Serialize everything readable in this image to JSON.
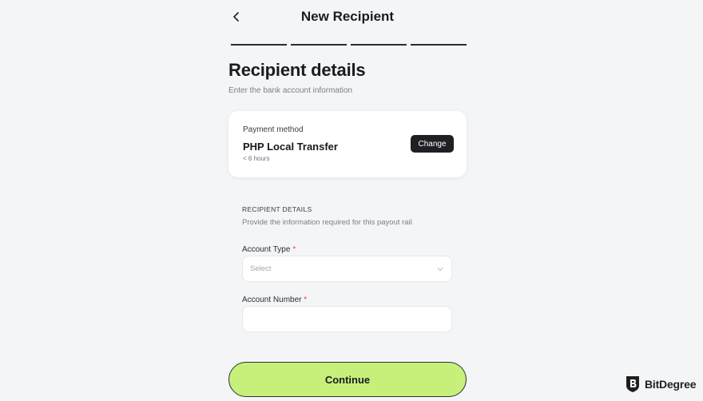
{
  "header": {
    "back_icon": "chevron-left-icon",
    "title": "New Recipient",
    "steps_count": 4
  },
  "section": {
    "title": "Recipient details",
    "subtitle": "Enter the bank account information"
  },
  "payment_method": {
    "label": "Payment method",
    "value": "PHP Local Transfer",
    "eta": "< 6 hours",
    "change_label": "Change"
  },
  "recipient_details": {
    "heading": "RECIPIENT DETAILS",
    "subtitle": "Provide the information required for this payout rail"
  },
  "fields": {
    "account_type": {
      "label": "Account Type",
      "required_mark": "*",
      "placeholder": "Select",
      "icon": "chevron-down-icon"
    },
    "account_number": {
      "label": "Account Number",
      "required_mark": "*",
      "value": ""
    }
  },
  "actions": {
    "continue_label": "Continue"
  },
  "watermark": {
    "text": "BitDegree",
    "icon": "bitdegree-shield-icon"
  },
  "colors": {
    "background": "#f4f5f7",
    "accent": "#c6f07a",
    "dark_button": "#1f2024",
    "required": "#e0453a"
  }
}
